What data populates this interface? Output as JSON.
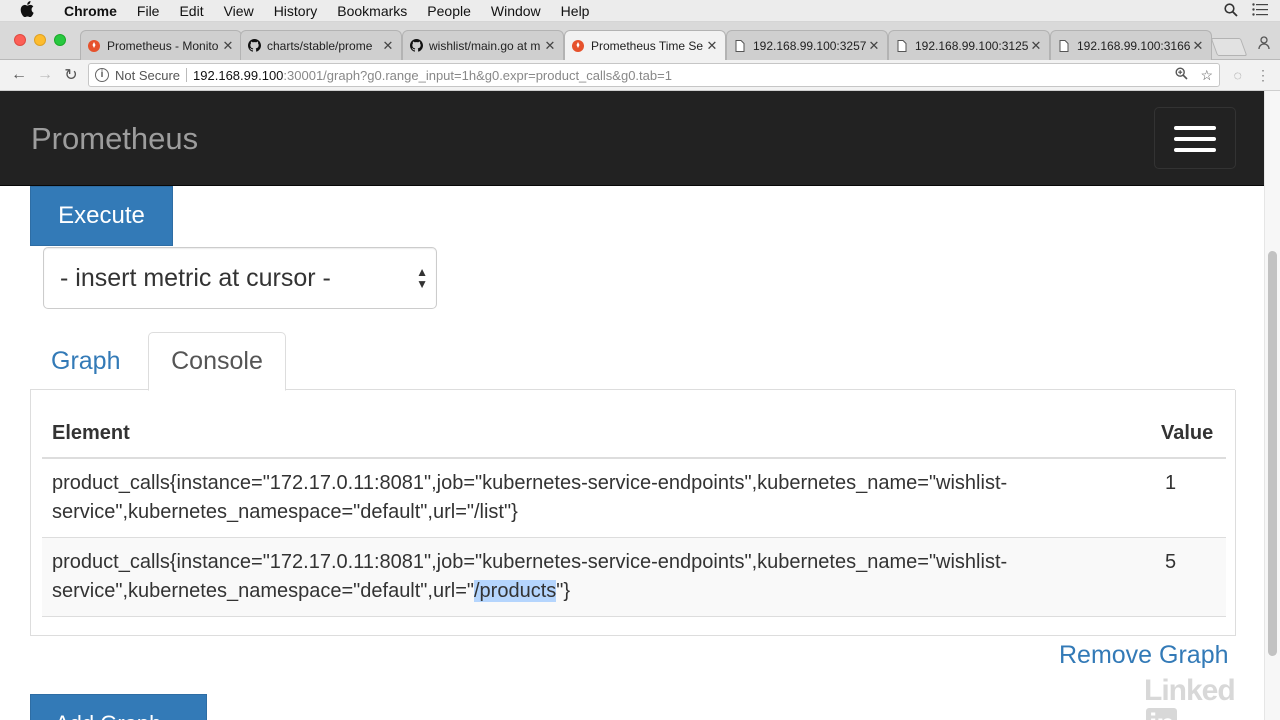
{
  "menubar": {
    "apple": "",
    "app": "Chrome",
    "items": [
      "File",
      "Edit",
      "View",
      "History",
      "Bookmarks",
      "People",
      "Window",
      "Help"
    ]
  },
  "browser": {
    "tabs": [
      {
        "title": "Prometheus - Monito",
        "icon": "prometheus-icon",
        "active": false
      },
      {
        "title": "charts/stable/prome",
        "icon": "github-icon",
        "active": false
      },
      {
        "title": "wishlist/main.go at m",
        "icon": "github-icon",
        "active": false
      },
      {
        "title": "Prometheus Time Se",
        "icon": "prometheus-icon",
        "active": true
      },
      {
        "title": "192.168.99.100:3257",
        "icon": "page-icon",
        "active": false
      },
      {
        "title": "192.168.99.100:3125",
        "icon": "page-icon",
        "active": false
      },
      {
        "title": "192.168.99.100:3166",
        "icon": "page-icon",
        "active": false
      }
    ],
    "address": {
      "security": "Not Secure",
      "host": "192.168.99.100",
      "path": ":30001/graph?g0.range_input=1h&g0.expr=product_calls&g0.tab=1"
    }
  },
  "app": {
    "brand": "Prometheus",
    "execute_label": "Execute",
    "metric_select": "- insert metric at cursor -",
    "tabs": {
      "graph": "Graph",
      "console": "Console"
    },
    "table": {
      "headers": {
        "element": "Element",
        "value": "Value"
      },
      "rows": [
        {
          "element": "product_calls{instance=\"172.17.0.11:8081\",job=\"kubernetes-service-endpoints\",kubernetes_name=\"wishlist-service\",kubernetes_namespace=\"default\",url=\"/list\"}",
          "value": "1"
        },
        {
          "element_prefix": "product_calls{instance=\"172.17.0.11:8081\",job=\"kubernetes-service-endpoints\",kubernetes_name=\"wishlist-service\",kubernetes_namespace=\"default\",url=\"",
          "element_highlight": "/products",
          "element_suffix": "\"}",
          "value": "5"
        }
      ]
    },
    "remove_graph": "Remove Graph",
    "add_graph": "Add Graph"
  },
  "watermark": {
    "text": "Linked",
    "badge": "in"
  },
  "colors": {
    "primary": "#337ab7",
    "navbar": "#222222",
    "highlight": "#b5d5fd"
  }
}
